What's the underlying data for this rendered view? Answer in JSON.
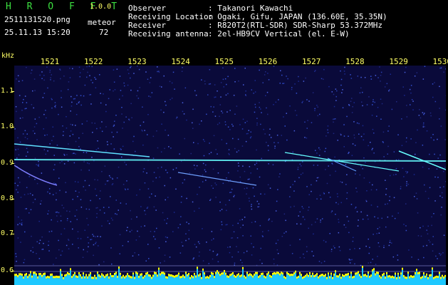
{
  "brand": "H R O F F T",
  "version": "1.0.0",
  "filename": "2511131520.png",
  "meteor_label": "meteor",
  "datetime": "25.11.13 15:20",
  "meteor_count": "72",
  "info": [
    {
      "label": "Observer",
      "value": ": Takanori Kawachi"
    },
    {
      "label": "Receiving Location",
      "value": ": Ogaki, Gifu, JAPAN (136.60E, 35.35N)"
    },
    {
      "label": "Receiver",
      "value": ": R820T2(RTL-SDR) SDR-Sharp 53.372MHz"
    },
    {
      "label": "Receiving antenna",
      "value": ": 2el-HB9CV Vertical (el. E-W)"
    }
  ],
  "x_unit": "kHz",
  "x_ticks": [
    "1521",
    "1522",
    "1523",
    "1524",
    "1525",
    "1526",
    "1527",
    "1528",
    "1529",
    "1530"
  ],
  "y_ticks": [
    "1.1",
    "1.0",
    "0.9",
    "0.8",
    "0.7",
    "0.6"
  ],
  "colors": {
    "background": "#0a0a3a",
    "trace": "#66ffff",
    "signal": "#ffff00",
    "noise_floor": "#1ec8ff"
  }
}
